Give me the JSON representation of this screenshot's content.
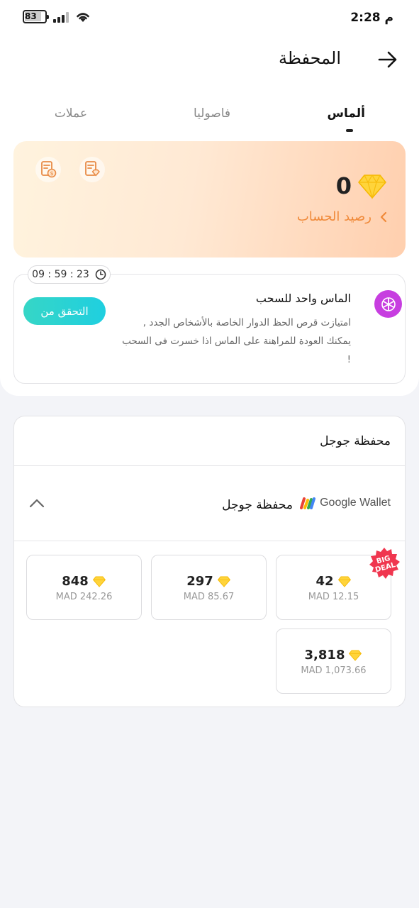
{
  "status_bar": {
    "time": "2:28 م",
    "battery": "83"
  },
  "header": {
    "title": "المحفظة"
  },
  "tabs": [
    {
      "label": "ألماس",
      "active": true
    },
    {
      "label": "فاصوليا",
      "active": false
    },
    {
      "label": "عملات",
      "active": false
    }
  ],
  "balance": {
    "amount": "0",
    "link_label": "رصيد الحساب"
  },
  "task": {
    "timer": "09 : 59 : 23",
    "title": "الماس واحد للسحب",
    "description": "امتيازت قرص الحظ الدوار الخاصة بالأشخاص الجدد , يمكنك العودة للمراهنة على الماس اذا خسرت فى السحب !",
    "button": "التحقق من"
  },
  "wallet": {
    "section_title": "محفظة جوجل",
    "method_label": "محفظة جوجل",
    "brand": "Google Wallet",
    "badge": "BIG DEAL",
    "packages": [
      {
        "diamonds": "42",
        "price": "MAD 12.15",
        "badge": true
      },
      {
        "diamonds": "297",
        "price": "MAD 85.67",
        "badge": false
      },
      {
        "diamonds": "848",
        "price": "MAD 242.26",
        "badge": false
      },
      {
        "diamonds": "3,818",
        "price": "MAD 1,073.66",
        "badge": false
      }
    ]
  },
  "colors": {
    "accent_orange": "#f08a3a",
    "teal": "#1fcfe0",
    "diamond": "#ffd43b",
    "purple": "#c73ee0"
  }
}
